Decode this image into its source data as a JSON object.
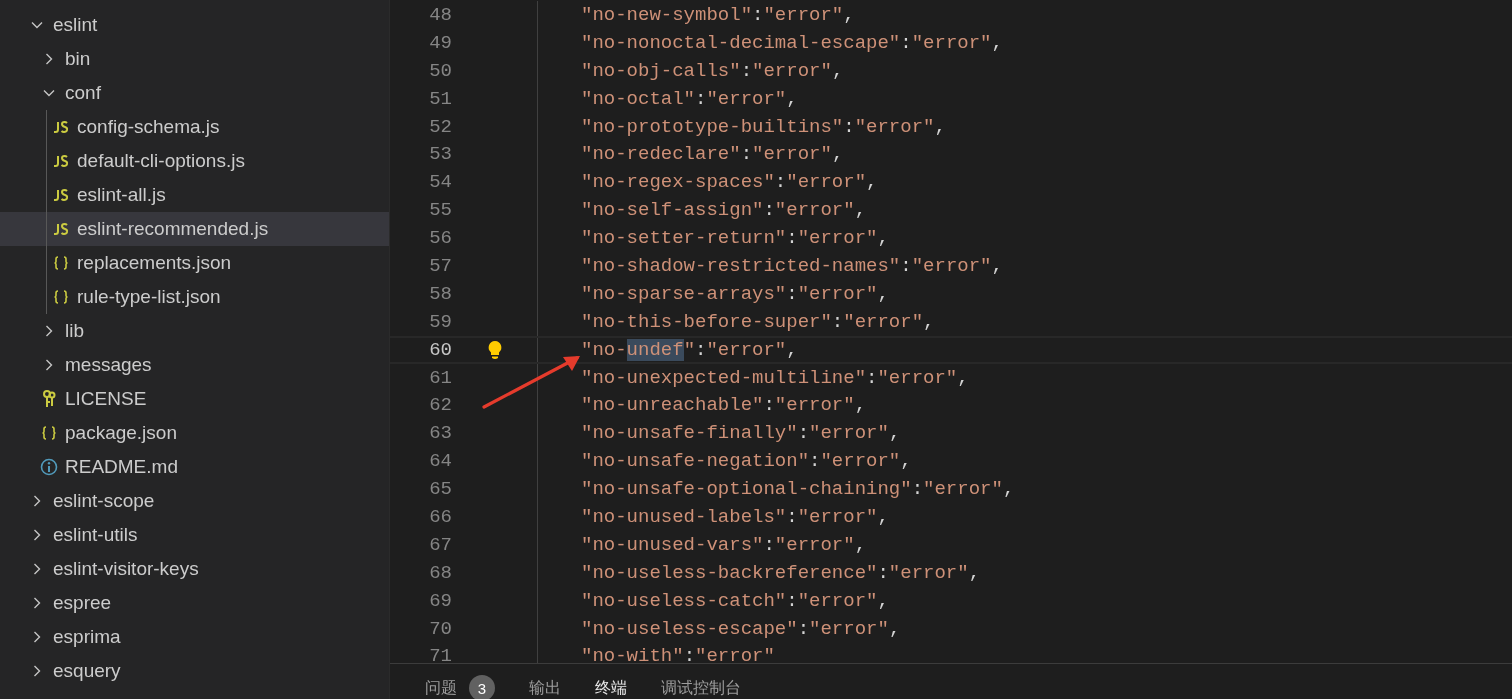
{
  "explorer": {
    "items": [
      {
        "name": "eslint",
        "kind": "folder",
        "expanded": true,
        "selected": false,
        "children": [
          {
            "name": "bin",
            "kind": "folder",
            "expanded": false,
            "selected": false
          },
          {
            "name": "conf",
            "kind": "folder",
            "expanded": true,
            "selected": false,
            "children": [
              {
                "name": "config-schema.js",
                "kind": "js",
                "selected": false
              },
              {
                "name": "default-cli-options.js",
                "kind": "js",
                "selected": false
              },
              {
                "name": "eslint-all.js",
                "kind": "js",
                "selected": false
              },
              {
                "name": "eslint-recommended.js",
                "kind": "js",
                "selected": true
              },
              {
                "name": "replacements.json",
                "kind": "json",
                "selected": false
              },
              {
                "name": "rule-type-list.json",
                "kind": "json",
                "selected": false
              }
            ]
          },
          {
            "name": "lib",
            "kind": "folder",
            "expanded": false,
            "selected": false
          },
          {
            "name": "messages",
            "kind": "folder",
            "expanded": false,
            "selected": false
          },
          {
            "name": "LICENSE",
            "kind": "license",
            "selected": false
          },
          {
            "name": "package.json",
            "kind": "json",
            "selected": false
          },
          {
            "name": "README.md",
            "kind": "info",
            "selected": false
          }
        ]
      },
      {
        "name": "eslint-scope",
        "kind": "folder",
        "expanded": false,
        "selected": false
      },
      {
        "name": "eslint-utils",
        "kind": "folder",
        "expanded": false,
        "selected": false
      },
      {
        "name": "eslint-visitor-keys",
        "kind": "folder",
        "expanded": false,
        "selected": false
      },
      {
        "name": "espree",
        "kind": "folder",
        "expanded": false,
        "selected": false
      },
      {
        "name": "esprima",
        "kind": "folder",
        "expanded": false,
        "selected": false
      },
      {
        "name": "esquery",
        "kind": "folder",
        "expanded": false,
        "selected": false
      }
    ]
  },
  "editor": {
    "lines": [
      {
        "number": "48",
        "key": "\"no-new-symbol\"",
        "colon": ":",
        "value": "\"error\"",
        "end": ",",
        "current": false
      },
      {
        "number": "49",
        "key": "\"no-nonoctal-decimal-escape\"",
        "colon": ":",
        "value": "\"error\"",
        "end": ",",
        "current": false
      },
      {
        "number": "50",
        "key": "\"no-obj-calls\"",
        "colon": ":",
        "value": "\"error\"",
        "end": ",",
        "current": false
      },
      {
        "number": "51",
        "key": "\"no-octal\"",
        "colon": ":",
        "value": "\"error\"",
        "end": ",",
        "current": false
      },
      {
        "number": "52",
        "key": "\"no-prototype-builtins\"",
        "colon": ":",
        "value": "\"error\"",
        "end": ",",
        "current": false
      },
      {
        "number": "53",
        "key": "\"no-redeclare\"",
        "colon": ":",
        "value": "\"error\"",
        "end": ",",
        "current": false
      },
      {
        "number": "54",
        "key": "\"no-regex-spaces\"",
        "colon": ":",
        "value": "\"error\"",
        "end": ",",
        "current": false
      },
      {
        "number": "55",
        "key": "\"no-self-assign\"",
        "colon": ":",
        "value": "\"error\"",
        "end": ",",
        "current": false
      },
      {
        "number": "56",
        "key": "\"no-setter-return\"",
        "colon": ":",
        "value": "\"error\"",
        "end": ",",
        "current": false
      },
      {
        "number": "57",
        "key": "\"no-shadow-restricted-names\"",
        "colon": ":",
        "value": "\"error\"",
        "end": ",",
        "current": false
      },
      {
        "number": "58",
        "key": "\"no-sparse-arrays\"",
        "colon": ":",
        "value": "\"error\"",
        "end": ",",
        "current": false
      },
      {
        "number": "59",
        "key": "\"no-this-before-super\"",
        "colon": ":",
        "value": "\"error\"",
        "end": ",",
        "current": false
      },
      {
        "number": "60",
        "key": "\"no-",
        "selected_text": "undef",
        "key_rest": "\"",
        "colon": ":",
        "value": "\"error\"",
        "end": ",",
        "current": true,
        "lightbulb": true
      },
      {
        "number": "61",
        "key": "\"no-unexpected-multiline\"",
        "colon": ":",
        "value": "\"error\"",
        "end": ",",
        "current": false
      },
      {
        "number": "62",
        "key": "\"no-unreachable\"",
        "colon": ":",
        "value": "\"error\"",
        "end": ",",
        "current": false
      },
      {
        "number": "63",
        "key": "\"no-unsafe-finally\"",
        "colon": ":",
        "value": "\"error\"",
        "end": ",",
        "current": false
      },
      {
        "number": "64",
        "key": "\"no-unsafe-negation\"",
        "colon": ":",
        "value": "\"error\"",
        "end": ",",
        "current": false
      },
      {
        "number": "65",
        "key": "\"no-unsafe-optional-chaining\"",
        "colon": ":",
        "value": "\"error\"",
        "end": ",",
        "current": false
      },
      {
        "number": "66",
        "key": "\"no-unused-labels\"",
        "colon": ":",
        "value": "\"error\"",
        "end": ",",
        "current": false
      },
      {
        "number": "67",
        "key": "\"no-unused-vars\"",
        "colon": ":",
        "value": "\"error\"",
        "end": ",",
        "current": false
      },
      {
        "number": "68",
        "key": "\"no-useless-backreference\"",
        "colon": ":",
        "value": "\"error\"",
        "end": ",",
        "current": false
      },
      {
        "number": "69",
        "key": "\"no-useless-catch\"",
        "colon": ":",
        "value": "\"error\"",
        "end": ",",
        "current": false
      },
      {
        "number": "70",
        "key": "\"no-useless-escape\"",
        "colon": ":",
        "value": "\"error\"",
        "end": ",",
        "current": false
      },
      {
        "number": "71",
        "key": "\"no-with\"",
        "colon": ":",
        "value": "\"error\"",
        "current": false
      }
    ]
  },
  "panel": {
    "tabs": [
      {
        "label": "问题",
        "badge": "3",
        "selected": false
      },
      {
        "label": "输出",
        "selected": false
      },
      {
        "label": "终端",
        "selected": true
      },
      {
        "label": "调试控制台",
        "selected": false
      }
    ]
  }
}
